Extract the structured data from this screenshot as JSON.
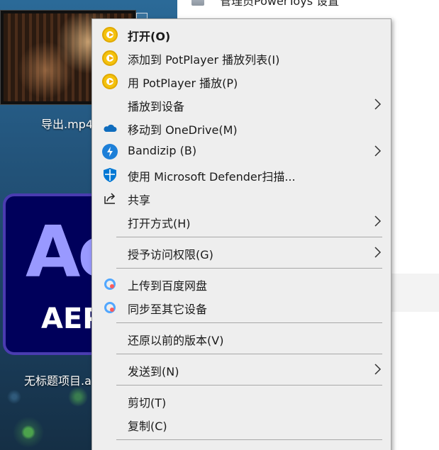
{
  "desktop": {
    "video_file": {
      "label": "导出.mp4"
    },
    "ae_project": {
      "letters": "Ae",
      "caption": "AEP",
      "label": "无标题项目.aep"
    }
  },
  "explorer": {
    "top_row_text": "管理员PowerToys 设置"
  },
  "context_menu": {
    "items": [
      {
        "label": "打开(O)",
        "icon": "potplayer-icon",
        "bold": true,
        "submenu": false
      },
      {
        "label": "添加到 PotPlayer 播放列表(I)",
        "icon": "potplayer-icon",
        "submenu": false
      },
      {
        "label": "用 PotPlayer 播放(P)",
        "icon": "potplayer-icon",
        "submenu": false
      },
      {
        "label": "播放到设备",
        "icon": "",
        "submenu": true
      },
      {
        "label": "移动到 OneDrive(M)",
        "icon": "onedrive-icon",
        "submenu": false
      },
      {
        "label": "Bandizip (B)",
        "icon": "bandizip-icon",
        "submenu": true
      },
      {
        "label": "使用 Microsoft Defender扫描...",
        "icon": "defender-shield-icon",
        "submenu": false
      },
      {
        "label": "共享",
        "icon": "share-icon",
        "submenu": false
      },
      {
        "label": "打开方式(H)",
        "icon": "",
        "submenu": true
      },
      {
        "label": "授予访问权限(G)",
        "icon": "",
        "submenu": true
      },
      {
        "label": "上传到百度网盘",
        "icon": "baidu-netdisk-icon",
        "submenu": false
      },
      {
        "label": "同步至其它设备",
        "icon": "baidu-netdisk-icon",
        "submenu": false
      },
      {
        "label": "还原以前的版本(V)",
        "icon": "",
        "submenu": false
      },
      {
        "label": "发送到(N)",
        "icon": "",
        "submenu": true
      },
      {
        "label": "剪切(T)",
        "icon": "",
        "submenu": false
      },
      {
        "label": "复制(C)",
        "icon": "",
        "submenu": false
      }
    ]
  },
  "colors": {
    "menu_background": "#eeeeee",
    "potplayer_yellow": "#f4c20d",
    "onedrive_blue": "#0f6cbd",
    "bandizip_blue": "#1d7fd8",
    "defender_blue": "#0078d4",
    "ae_purple": "#9999ff",
    "ae_background": "#00005b"
  }
}
